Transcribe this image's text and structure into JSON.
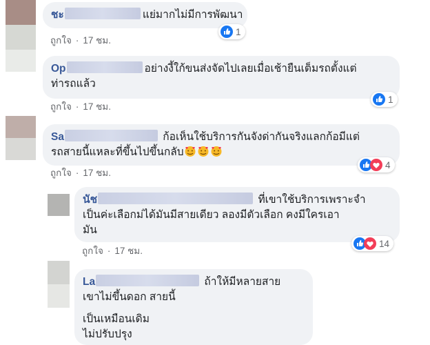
{
  "comments": [
    {
      "name": "ชะ",
      "text": "แย่มากไม่มีการพัฒนา",
      "like_label": "ถูกใจ",
      "time": "17 ชม.",
      "reaction_count": "1"
    },
    {
      "name": "Op",
      "text1": "อย่างงี้ใก้ขนส่งจัดไปเลยเมื่อเช้ายืนเต็มรถตั้งแต่",
      "text2": "ท่ารถแล้ว",
      "like_label": "ถูกใจ",
      "time": "17 ชม.",
      "reaction_count": "1"
    },
    {
      "name": "Sa",
      "text1": "ก้อเห็นใช้บริการกันจังด่ากันจริงแลกก้อมีแต่",
      "text2": "รถสายนี้แหละที่ขึ้นไปขึ้นกลับ",
      "like_label": "ถูกใจ",
      "time": "17 ชม.",
      "reaction_count": "4"
    },
    {
      "name": "นัช",
      "text1": "ที่เขาใช้บริการเพราะจำ",
      "text2": "เป็นค่ะเลือกม่ได้มันมีสายเดียว ลองมีตัวเลือก คงมีใครเอา",
      "text3": "มัน",
      "like_label": "ถูกใจ",
      "time": "17 ชม.",
      "reaction_count": "14"
    },
    {
      "name": "La",
      "text1": "ถ้าให้มีหลายสาย",
      "text2": "เขาไม่ขึ้นดอก สายนี้",
      "text3": "เป็นเหมือนเดิม",
      "text4": "ไม่ปรับปรุง"
    }
  ],
  "icons": {
    "like": "thumbs-up-icon",
    "love": "heart-icon",
    "emoji": "smiling-face-with-hearts-icon"
  },
  "colors": {
    "name": "#385898",
    "meta": "#65676b",
    "bubble": "#f0f2f5",
    "like": "#1877f2",
    "love": "#f33e58"
  }
}
